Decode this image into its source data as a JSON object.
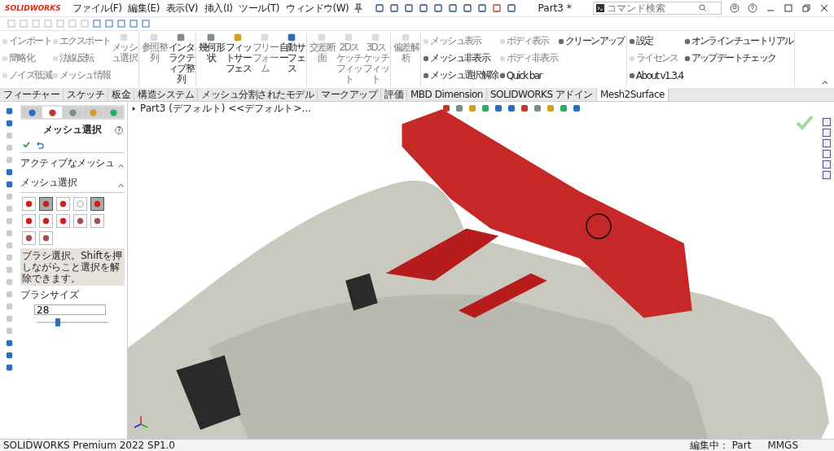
{
  "app": {
    "logo": "SOLIDWORKS",
    "menus": [
      "ファイル(F)",
      "編集(E)",
      "表示(V)",
      "挿入(I)",
      "ツール(T)",
      "ウィンドウ(W)"
    ],
    "title": "Part3 *",
    "search": {
      "placeholder": "コマンド検索"
    }
  },
  "ribbon": {
    "groups": [
      {
        "items": [
          {
            "kind": "small",
            "label": "インポート",
            "disabled": true
          },
          {
            "kind": "small",
            "label": "簡略化",
            "disabled": true
          },
          {
            "kind": "small",
            "label": "ノイズ低減",
            "disabled": true
          },
          {
            "kind": "small",
            "label": "エクスポート",
            "disabled": true
          },
          {
            "kind": "small",
            "label": "法線反転",
            "disabled": true
          },
          {
            "kind": "small",
            "label": "メッシュ情報",
            "disabled": true
          },
          {
            "kind": "large",
            "label": "メッシュ選択",
            "disabled": true
          }
        ]
      },
      {
        "items": [
          {
            "kind": "large",
            "label": "参照整列",
            "disabled": true
          },
          {
            "kind": "large",
            "label": "インタラクティブ整列",
            "disabled": false
          }
        ]
      },
      {
        "items": [
          {
            "kind": "large",
            "label": "幾何形状",
            "disabled": false
          },
          {
            "kind": "large",
            "label": "フィットサーフェス",
            "disabled": false
          },
          {
            "kind": "large",
            "label": "フリーフォーム",
            "disabled": true
          },
          {
            "kind": "large",
            "label": "自動サーフェス",
            "disabled": false
          }
        ]
      },
      {
        "items": [
          {
            "kind": "large",
            "label": "交差断面",
            "disabled": true
          },
          {
            "kind": "large",
            "label": "2Dスケッチフィット",
            "disabled": true
          },
          {
            "kind": "large",
            "label": "3Dスケッチフィット",
            "disabled": true
          }
        ]
      },
      {
        "items": [
          {
            "kind": "large",
            "label": "偏差解析",
            "disabled": true
          }
        ]
      },
      {
        "items": [
          {
            "kind": "small",
            "label": "メッシュ表示",
            "disabled": true
          },
          {
            "kind": "small",
            "label": "メッシュ非表示",
            "disabled": false
          },
          {
            "kind": "small",
            "label": "メッシュ選択解除",
            "disabled": false
          },
          {
            "kind": "small",
            "label": "ボディ表示",
            "disabled": true
          },
          {
            "kind": "small",
            "label": "ボディ非表示",
            "disabled": true
          },
          {
            "kind": "small",
            "label": "Quick bar",
            "disabled": false
          },
          {
            "kind": "small",
            "label": "クリーンアップ",
            "disabled": false
          }
        ]
      },
      {
        "items": [
          {
            "kind": "small",
            "label": "設定",
            "disabled": false
          },
          {
            "kind": "small",
            "label": "ライセンス",
            "disabled": true
          },
          {
            "kind": "small",
            "label": "About v1.3.4",
            "disabled": false
          },
          {
            "kind": "small",
            "label": "オンラインチュートリアル",
            "disabled": false
          },
          {
            "kind": "small",
            "label": "アップデートチェック",
            "disabled": false
          }
        ]
      }
    ]
  },
  "tabs": [
    {
      "label": "フィーチャー",
      "selected": false
    },
    {
      "label": "スケッチ",
      "selected": false
    },
    {
      "label": "板金",
      "selected": false
    },
    {
      "label": "構造システム",
      "selected": false
    },
    {
      "label": "メッシュ分割されたモデル",
      "selected": false
    },
    {
      "label": "マークアップ",
      "selected": false
    },
    {
      "label": "評価",
      "selected": false
    },
    {
      "label": "MBD Dimension",
      "selected": false
    },
    {
      "label": "SOLIDWORKS アドイン",
      "selected": false
    },
    {
      "label": "Mesh2Surface",
      "selected": true
    }
  ],
  "property_manager": {
    "panel_tabs": [
      {
        "selected": false
      },
      {
        "selected": true
      },
      {
        "selected": false
      },
      {
        "selected": false
      },
      {
        "selected": false
      }
    ],
    "title": "メッシュ選択",
    "help": "?",
    "sections": [
      {
        "title": "アクティブなメッシュ",
        "expanded": true
      },
      {
        "title": "メッシュ選択",
        "expanded": true
      }
    ],
    "tools": [
      {
        "selected": false
      },
      {
        "selected": true
      },
      {
        "selected": false
      },
      {
        "selected": false
      },
      {
        "selected": true
      },
      {
        "selected": false
      },
      {
        "selected": false
      },
      {
        "selected": false
      },
      {
        "selected": false
      },
      {
        "selected": false
      },
      {
        "selected": false
      },
      {
        "selected": false
      }
    ],
    "message": "ブラシ選択。Shiftを押しながらこと選択を解除できます。",
    "brush_size": {
      "label": "ブラシサイズ",
      "value": "28",
      "level": 0.3
    }
  },
  "feature_tree": {
    "item": "Part3 (デフォルト) <<デフォルト>..."
  },
  "status_bar": {
    "product": "SOLIDWORKS Premium 2022 SP1.0",
    "mode": "編集中： Part",
    "units": "MMGS"
  }
}
